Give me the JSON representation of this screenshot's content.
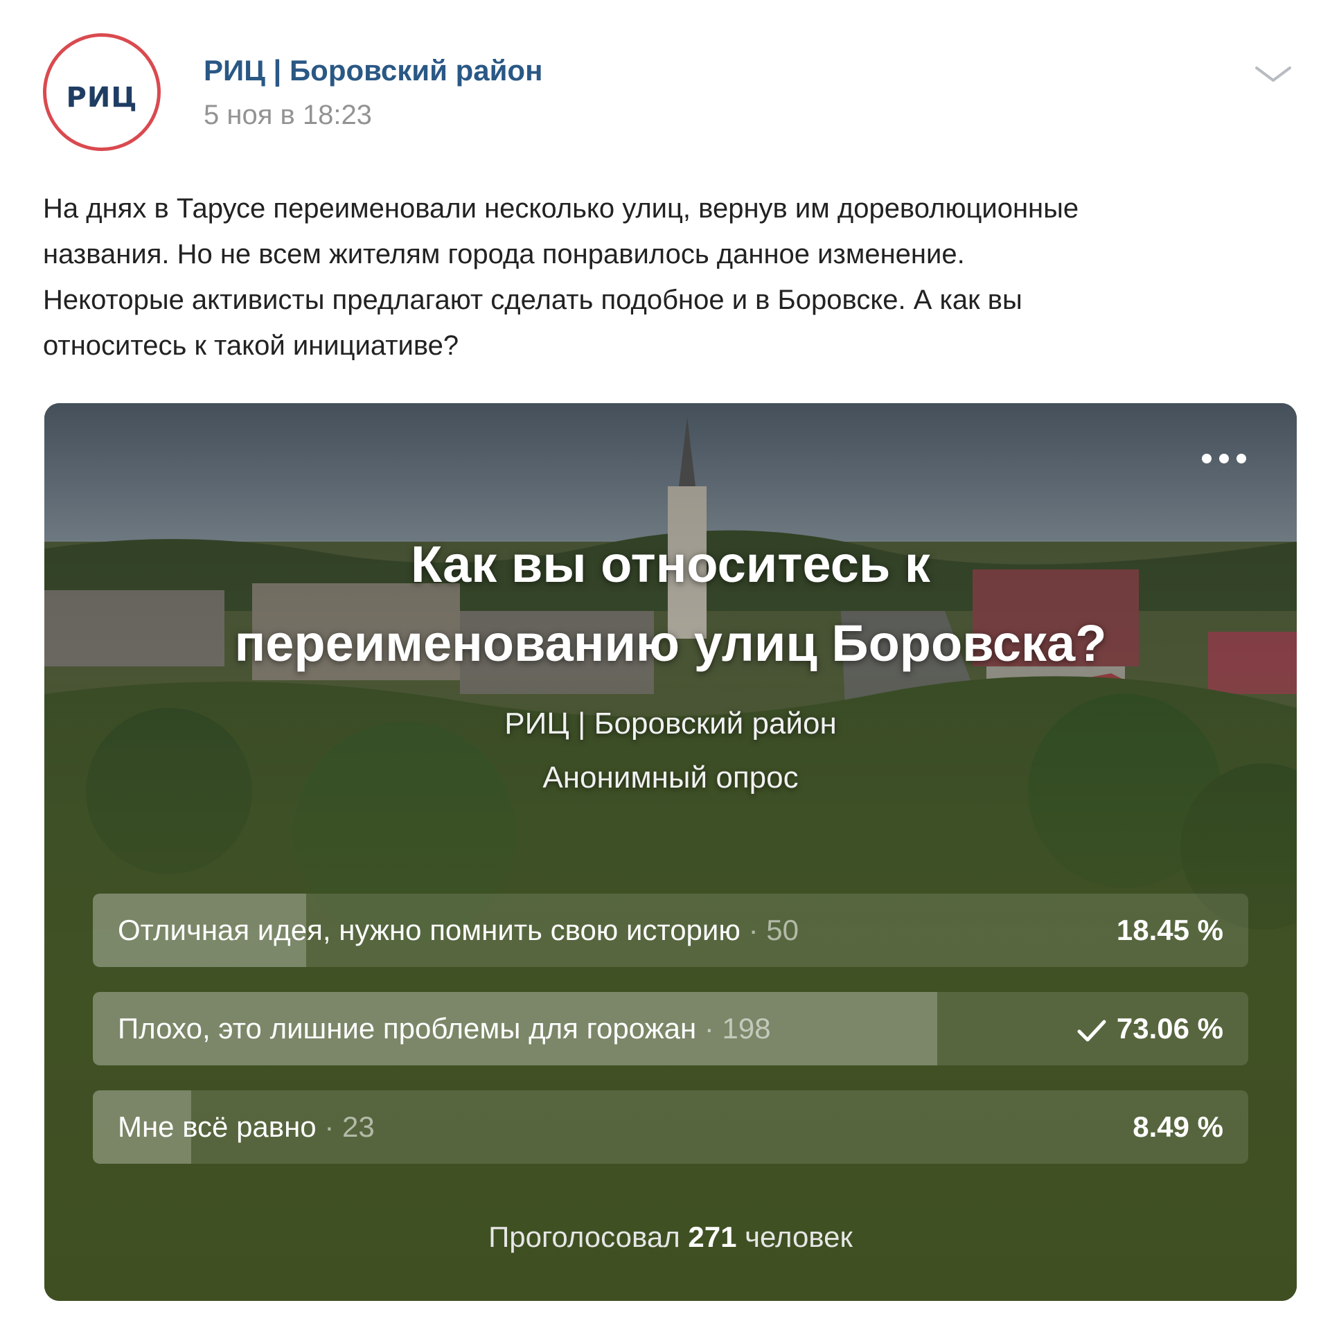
{
  "post": {
    "avatar_text": "РИЦ",
    "author": "РИЦ | Боровский район",
    "date": "5 ноя в 18:23",
    "text_lines": [
      "На днях в Тарусе переименовали несколько улиц, вернув им дореволюционные",
      "названия. Но не всем жителям города понравилось данное изменение.",
      "Некоторые активисты предлагают сделать подобное и в Боровске. А как вы",
      "относитесь к такой инициативе?"
    ]
  },
  "poll": {
    "title_lines": [
      "Как вы относитесь к",
      "переименованию улиц Боровска?"
    ],
    "owner": "РИЦ | Боровский район",
    "type": "Анонимный опрос",
    "options": [
      {
        "text": "Отличная идея, нужно помнить свою историю",
        "count": "· 50",
        "percent": "18.45 %",
        "fraction": 0.1845
      },
      {
        "text": "Плохо, это лишние проблемы для горожан",
        "count": "· 198",
        "percent": "73.06 %",
        "fraction": 0.7306
      },
      {
        "text": "Мне всё равно",
        "count": "· 23",
        "percent": "8.49 %",
        "fraction": 0.0849
      }
    ],
    "total_prefix": "Проголосовал",
    "total_count": "271",
    "total_suffix": "человек"
  },
  "icons": {
    "header_menu": "chevron-down-icon",
    "poll_menu": "more-icon",
    "voted": "check-icon"
  },
  "colors": {
    "author_link": "#2a5885",
    "date_gray": "#939393",
    "poll_background": "#3f4f22",
    "avatar_ring": "#d94a4f"
  }
}
